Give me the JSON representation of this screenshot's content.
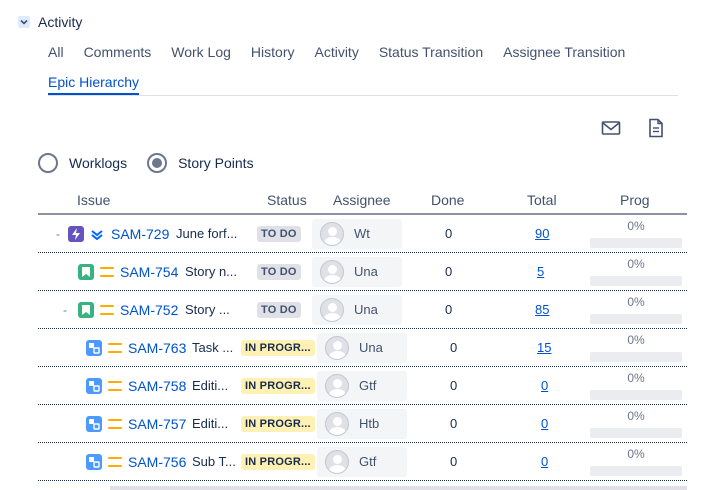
{
  "activity": {
    "title": "Activity"
  },
  "tabs": {
    "row1": [
      "All",
      "Comments",
      "Work Log",
      "History",
      "Activity",
      "Status Transition",
      "Assignee Transition"
    ],
    "active": "Epic Hierarchy"
  },
  "toolbar": {
    "email_icon": "envelope-icon",
    "export_icon": "document-icon"
  },
  "radios": {
    "worklogs": "Worklogs",
    "story_points": "Story Points",
    "selected": "story_points"
  },
  "table": {
    "headers": {
      "issue": "Issue",
      "status": "Status",
      "assignee": "Assignee",
      "done": "Done",
      "total": "Total",
      "prog": "Prog"
    },
    "rows": [
      {
        "expander": "-",
        "type": "epic",
        "type_color": "#6554c0",
        "key": "SAM-729",
        "summary": "June forf...",
        "status": "TO DO",
        "status_kind": "todo",
        "assignee": "Wt",
        "done": "0",
        "total": "90",
        "progress": "0%"
      },
      {
        "expander": "",
        "type": "story",
        "type_color": "#36b37e",
        "key": "SAM-754",
        "summary": "Story n...",
        "status": "TO DO",
        "status_kind": "todo",
        "assignee": "Una",
        "done": "0",
        "total": "5",
        "progress": "0%"
      },
      {
        "expander": "-",
        "type": "story",
        "type_color": "#36b37e",
        "key": "SAM-752",
        "summary": "Story ...",
        "status": "TO DO",
        "status_kind": "todo",
        "assignee": "Una",
        "done": "0",
        "total": "85",
        "progress": "0%"
      },
      {
        "expander": "",
        "type": "subtask",
        "type_color": "#4c9aff",
        "key": "SAM-763",
        "summary": "Task ...",
        "status": "IN PROGR...",
        "status_kind": "inprog",
        "assignee": "Una",
        "done": "0",
        "total": "15",
        "progress": "0%"
      },
      {
        "expander": "",
        "type": "subtask",
        "type_color": "#4c9aff",
        "key": "SAM-758",
        "summary": "Editi...",
        "status": "IN PROGR...",
        "status_kind": "inprog",
        "assignee": "Gtf",
        "done": "0",
        "total": "0",
        "progress": "0%"
      },
      {
        "expander": "",
        "type": "subtask",
        "type_color": "#4c9aff",
        "key": "SAM-757",
        "summary": "Editi...",
        "status": "IN PROGR...",
        "status_kind": "inprog",
        "assignee": "Htb",
        "done": "0",
        "total": "0",
        "progress": "0%"
      },
      {
        "expander": "",
        "type": "subtask",
        "type_color": "#4c9aff",
        "key": "SAM-756",
        "summary": "Sub T...",
        "status": "IN PROGR...",
        "status_kind": "inprog",
        "assignee": "Gtf",
        "done": "0",
        "total": "0",
        "progress": "0%"
      }
    ]
  },
  "colors": {
    "link": "#0052cc",
    "priority": "#ffab00",
    "todo_bg": "#dfe1e6",
    "inprog_bg": "#fff0b3"
  }
}
